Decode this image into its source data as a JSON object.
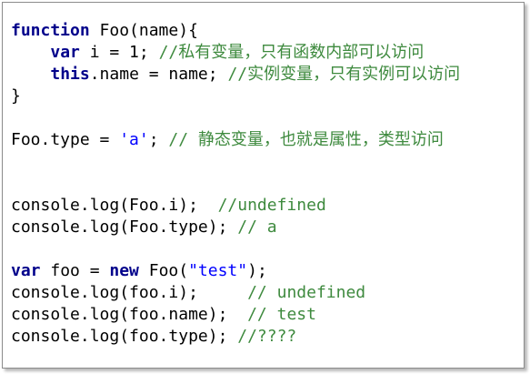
{
  "colors": {
    "keyword": "#00008b",
    "string": "#0000ff",
    "comment": "#3e8a3e",
    "text": "#000000",
    "background": "#ffffff",
    "border": "#8c8c8c"
  },
  "lines": [
    [
      [
        "kw",
        "function"
      ],
      [
        "pl",
        " Foo(name){"
      ]
    ],
    [
      [
        "pl",
        "    "
      ],
      [
        "kw",
        "var"
      ],
      [
        "pl",
        " i = 1; "
      ],
      [
        "cmt",
        "//私有变量，只有函数内部可以访问"
      ]
    ],
    [
      [
        "pl",
        "    "
      ],
      [
        "kw",
        "this"
      ],
      [
        "pl",
        ".name = name; "
      ],
      [
        "cmt",
        "//实例变量，只有实例可以访问"
      ]
    ],
    [
      [
        "pl",
        "}"
      ]
    ],
    [],
    [
      [
        "pl",
        "Foo.type = "
      ],
      [
        "str",
        "'a'"
      ],
      [
        "pl",
        "; "
      ],
      [
        "cmt",
        "// 静态变量，也就是属性，类型访问"
      ]
    ],
    [],
    [],
    [
      [
        "pl",
        "console.log(Foo.i);  "
      ],
      [
        "cmt",
        "//undefined"
      ]
    ],
    [
      [
        "pl",
        "console.log(Foo.type); "
      ],
      [
        "cmt",
        "// a"
      ]
    ],
    [],
    [
      [
        "kw",
        "var"
      ],
      [
        "pl",
        " foo = "
      ],
      [
        "kw",
        "new"
      ],
      [
        "pl",
        " Foo("
      ],
      [
        "str",
        "\"test\""
      ],
      [
        "pl",
        ");"
      ]
    ],
    [
      [
        "pl",
        "console.log(foo.i);     "
      ],
      [
        "cmt",
        "// undefined"
      ]
    ],
    [
      [
        "pl",
        "console.log(foo.name);  "
      ],
      [
        "cmt",
        "// test"
      ]
    ],
    [
      [
        "pl",
        "console.log(foo.type); "
      ],
      [
        "cmt",
        "//????"
      ]
    ]
  ]
}
